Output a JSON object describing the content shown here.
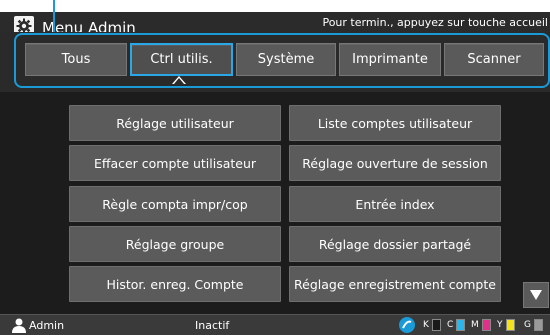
{
  "titlebar": {
    "title": "Menu Admin",
    "hint": "Pour termin., appuyez sur touche accueil",
    "icon": "gear-icon"
  },
  "tabs": [
    {
      "label": "Tous",
      "active": false
    },
    {
      "label": "Ctrl utilis.",
      "active": true
    },
    {
      "label": "Système",
      "active": false
    },
    {
      "label": "Imprimante",
      "active": false
    },
    {
      "label": "Scanner",
      "active": false
    }
  ],
  "menu": {
    "left": [
      "Réglage utilisateur",
      "Effacer compte utilisateur",
      "Règle compta impr/cop",
      "Réglage groupe",
      "Histor. enreg. Compte"
    ],
    "right": [
      "Liste comptes utilisateur",
      "Réglage ouverture de session",
      "Entrée index",
      "Réglage dossier partagé",
      "Réglage enregistrement compte"
    ]
  },
  "status": {
    "user": "Admin",
    "state": "Inactif",
    "toner": [
      {
        "label": "K",
        "color": "#1a1a1a"
      },
      {
        "label": "C",
        "color": "#2ab6e8"
      },
      {
        "label": "M",
        "color": "#e0308a"
      },
      {
        "label": "Y",
        "color": "#f4e21a"
      },
      {
        "label": "G",
        "color": "#9a9a9a"
      }
    ]
  },
  "colors": {
    "accent": "#1a9ad6"
  }
}
